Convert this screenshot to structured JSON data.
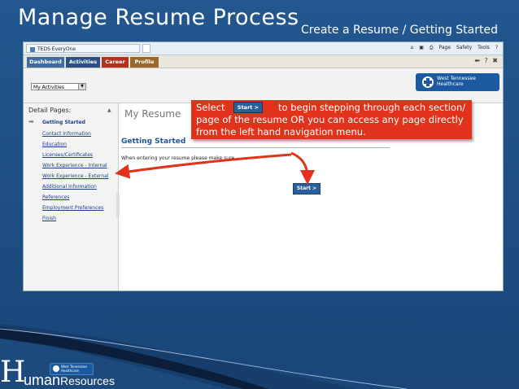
{
  "slide": {
    "title": "Manage Resume Process",
    "subtitle": "Create a Resume / Getting Started"
  },
  "browser": {
    "tab_title": "TEDS EveryOne",
    "tools": [
      "Page",
      "Safety",
      "Tools"
    ]
  },
  "app_nav": {
    "tabs": [
      "Dashboard",
      "Activities",
      "Career",
      "Profile"
    ]
  },
  "header": {
    "activities_select": "My Activities",
    "logo_line1": "West Tennessee",
    "logo_line2": "Healthcare"
  },
  "left_nav": {
    "heading": "Detail Pages:",
    "items": [
      "Getting Started",
      "Contact Information",
      "Education",
      "Licenses/Certificates",
      "Work Experience - Internal",
      "Work Experience - External",
      "Additional Information",
      "References",
      "Employment Preferences",
      "Finish"
    ]
  },
  "main": {
    "page_title": "My Resume",
    "section_heading": "Getting Started",
    "body_text": "When entering your resume please make sure",
    "start_button": "Start >"
  },
  "callout": {
    "line1_pre": "Select",
    "button": "Start >",
    "line1_post": "to begin stepping through each section/",
    "line2": "page of the resume OR you can access any page directly",
    "line3": "from the left hand navigation menu."
  },
  "footer": {
    "hr_big": "H",
    "hr_rest1": "uman",
    "hr_rest2": "Resources",
    "mini_logo_line1": "West Tennessee",
    "mini_logo_line2": "Healthcare"
  },
  "colors": {
    "slide_bg": "#1f4f86",
    "callout_bg": "#e1331c",
    "button_bg": "#2b5f99",
    "link": "#1a3e8c"
  }
}
